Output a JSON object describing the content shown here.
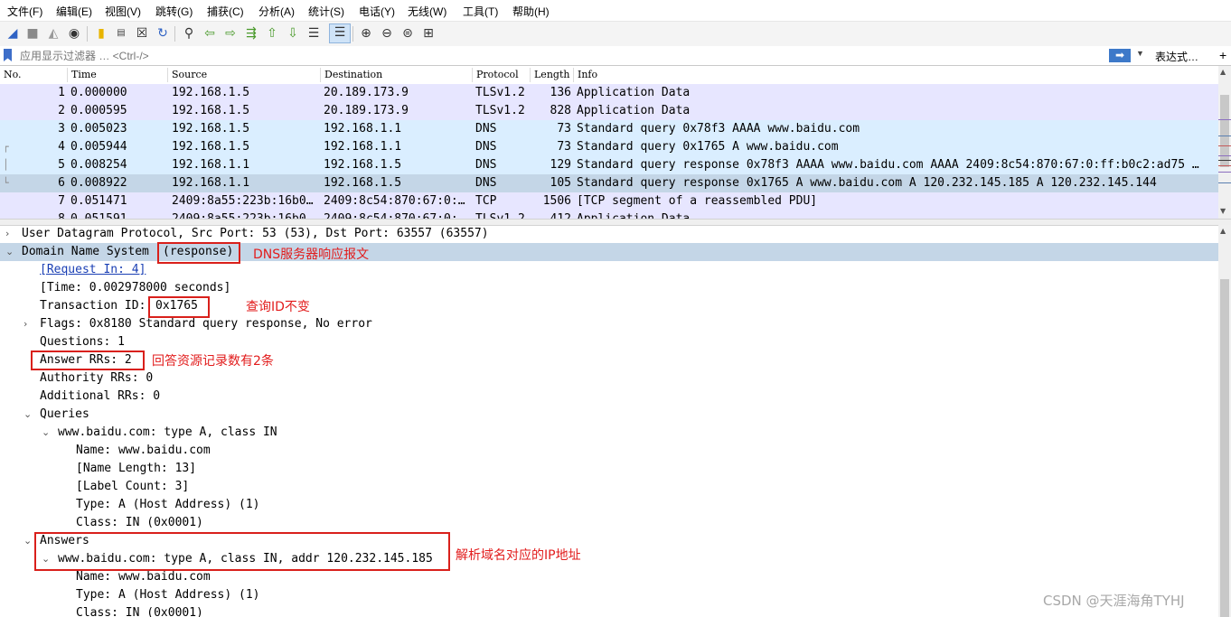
{
  "menu": [
    "文件(F)",
    "编辑(E)",
    "视图(V)",
    "跳转(G)",
    "捕获(C)",
    "分析(A)",
    "统计(S)",
    "电话(Y)",
    "无线(W)",
    "工具(T)",
    "帮助(H)"
  ],
  "toolbar": {
    "icons": [
      "shark-fin-icon",
      "stop-icon",
      "restart-icon",
      "options-gear-icon",
      "open-file-icon",
      "save-file-icon",
      "close-file-icon",
      "reload-icon",
      "find-icon",
      "back-icon",
      "forward-icon",
      "go-to-packet-icon",
      "first-packet-icon",
      "last-packet-icon",
      "autoscroll-icon",
      "colorize-icon",
      "zoom-in-icon",
      "zoom-out-icon",
      "zoom-reset-icon",
      "resize-columns-icon"
    ]
  },
  "filter": {
    "placeholder": "应用显示过滤器 … <Ctrl-/>",
    "apply_glyph": "➡",
    "expression_label": "表达式…",
    "plus": "+"
  },
  "packet_list": {
    "columns": [
      "No.",
      "Time",
      "Source",
      "Destination",
      "Protocol",
      "Length",
      "Info"
    ],
    "rows": [
      {
        "no": "1",
        "time": "0.000000",
        "src": "192.168.1.5",
        "dst": "20.189.173.9",
        "proto": "TLSv1.2",
        "len": "136",
        "info": "Application Data"
      },
      {
        "no": "2",
        "time": "0.000595",
        "src": "192.168.1.5",
        "dst": "20.189.173.9",
        "proto": "TLSv1.2",
        "len": "828",
        "info": "Application Data"
      },
      {
        "no": "3",
        "time": "0.005023",
        "src": "192.168.1.5",
        "dst": "192.168.1.1",
        "proto": "DNS",
        "len": "73",
        "info": "Standard query 0x78f3 AAAA www.baidu.com"
      },
      {
        "no": "4",
        "time": "0.005944",
        "src": "192.168.1.5",
        "dst": "192.168.1.1",
        "proto": "DNS",
        "len": "73",
        "info": "Standard query 0x1765 A www.baidu.com"
      },
      {
        "no": "5",
        "time": "0.008254",
        "src": "192.168.1.1",
        "dst": "192.168.1.5",
        "proto": "DNS",
        "len": "129",
        "info": "Standard query response 0x78f3 AAAA www.baidu.com AAAA 2409:8c54:870:67:0:ff:b0c2:ad75 …"
      },
      {
        "no": "6",
        "time": "0.008922",
        "src": "192.168.1.1",
        "dst": "192.168.1.5",
        "proto": "DNS",
        "len": "105",
        "info": "Standard query response 0x1765 A www.baidu.com A 120.232.145.185 A 120.232.145.144"
      },
      {
        "no": "7",
        "time": "0.051471",
        "src": "2409:8a55:223b:16b0…",
        "dst": "2409:8c54:870:67:0:…",
        "proto": "TCP",
        "len": "1506",
        "info": "[TCP segment of a reassembled PDU]"
      },
      {
        "no": "8",
        "time": "0.051591",
        "src": "2409:8a55:223b:16b0…",
        "dst": "2409:8c54:870:67:0:…",
        "proto": "TLSv1.2",
        "len": "412",
        "info": "Application Data"
      }
    ]
  },
  "details": {
    "udp": "User Datagram Protocol, Src Port: 53 (53), Dst Port: 63557 (63557)",
    "dns_prefix": "Domain Name System ",
    "dns_suffix": "(response)",
    "request_in": "[Request In: 4]",
    "time": "[Time: 0.002978000 seconds]",
    "txid_label": "Transaction ID: ",
    "txid_value": "0x1765",
    "flags": "Flags: 0x8180 Standard query response, No error",
    "questions": "Questions: 1",
    "answer_rrs": "Answer RRs: 2",
    "authority_rrs": "Authority RRs: 0",
    "additional_rrs": "Additional RRs: 0",
    "queries": "Queries",
    "query1": "www.baidu.com: type A, class IN",
    "q_name": "Name: www.baidu.com",
    "q_name_len": "[Name Length: 13]",
    "q_label_count": "[Label Count: 3]",
    "q_type": "Type: A (Host Address) (1)",
    "q_class": "Class: IN (0x0001)",
    "answers": "Answers",
    "answer1": "www.baidu.com: type A, class IN, addr 120.232.145.185",
    "a_name": "Name: www.baidu.com",
    "a_type": "Type: A (Host Address) (1)",
    "a_class": "Class: IN (0x0001)"
  },
  "annotations": {
    "dns_response": "DNS服务器响应报文",
    "txid_unchanged": "查询ID不变",
    "answer_count": "回答资源记录数有2条",
    "resolved_ip": "解析域名对应的IP地址"
  },
  "watermark": "CSDN @天涯海角TYHJ",
  "colors": {
    "tls_row": "#e7e6ff",
    "dns_row": "#daeeff",
    "selected_row": "#c4d6e7",
    "annotation_red": "#d9201b"
  }
}
